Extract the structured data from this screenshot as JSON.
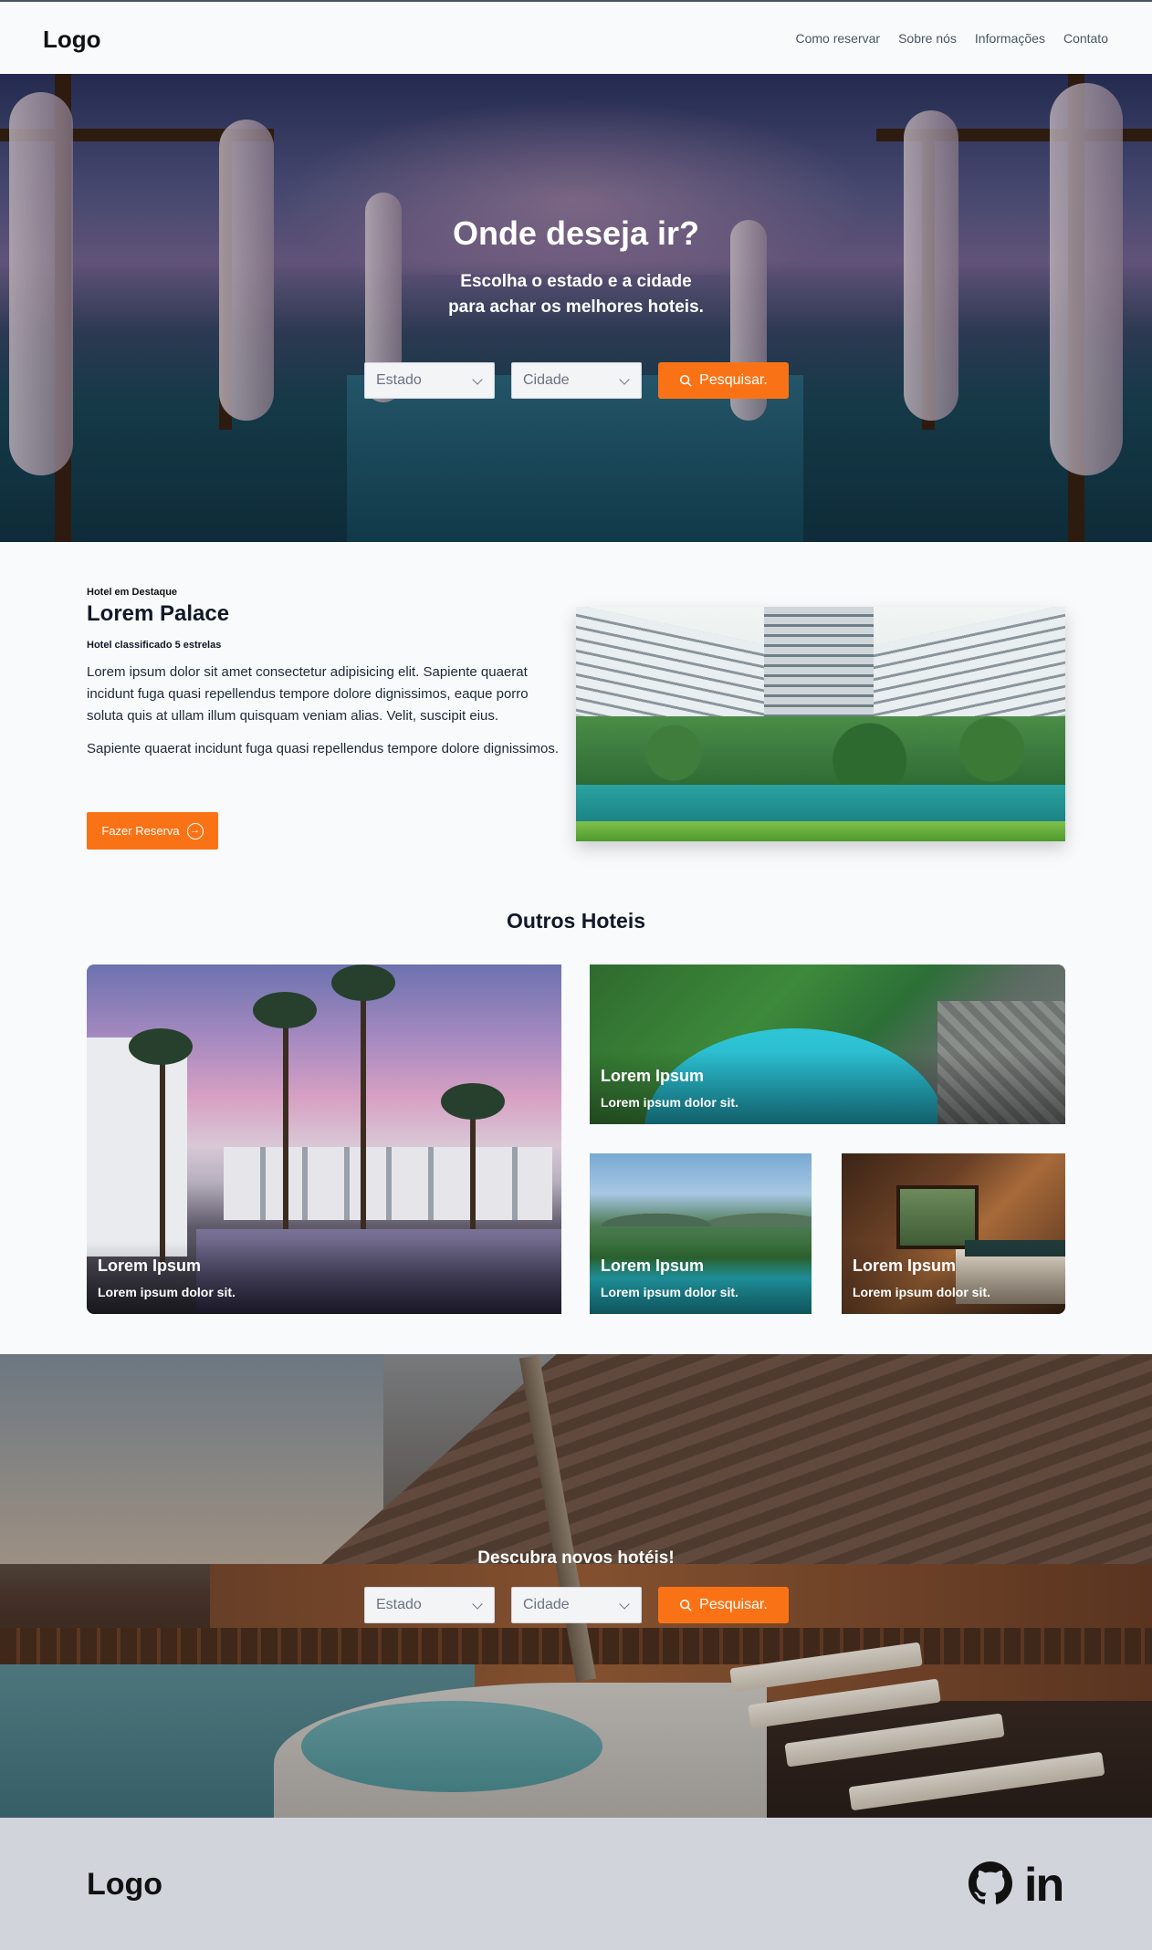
{
  "nav": {
    "logo": "Logo",
    "links": [
      "Como reservar",
      "Sobre nós",
      "Informações",
      "Contato"
    ]
  },
  "hero": {
    "title": "Onde deseja ir?",
    "subtitle_line1": "Escolha o estado e a cidade",
    "subtitle_line2": "para achar os melhores hoteis.",
    "state_placeholder": "Estado",
    "city_placeholder": "Cidade",
    "search_label": "Pesquisar."
  },
  "featured": {
    "eyebrow": "Hotel em Destaque",
    "title": "Lorem Palace",
    "rating": "Hotel classificado 5 estrelas",
    "paragraph1": "Lorem ipsum dolor sit amet consectetur adipisicing elit. Sapiente quaerat incidunt fuga quasi repellendus tempore dolore dignissimos, eaque porro soluta quis at ullam illum quisquam veniam alias. Velit, suscipit eius.",
    "paragraph2": "Sapiente quaerat incidunt fuga quasi repellendus tempore dolore dignissimos.",
    "button_label": "Fazer Reserva"
  },
  "others": {
    "title": "Outros Hoteis",
    "cards": [
      {
        "title": "Lorem Ipsum",
        "subtitle": "Lorem ipsum dolor sit."
      },
      {
        "title": "Lorem Ipsum",
        "subtitle": "Lorem ipsum dolor sit."
      },
      {
        "title": "Lorem Ipsum",
        "subtitle": "Lorem ipsum dolor sit."
      },
      {
        "title": "Lorem Ipsum",
        "subtitle": "Lorem ipsum dolor sit."
      }
    ]
  },
  "discover": {
    "title": "Descubra novos hotéis!",
    "state_placeholder": "Estado",
    "city_placeholder": "Cidade",
    "search_label": "Pesquisar."
  },
  "footer": {
    "logo": "Logo",
    "icons": [
      "github-icon",
      "linkedin-icon"
    ],
    "linkedin_text": "in"
  },
  "colors": {
    "accent": "#f97316",
    "footer_bg": "#d1d5db",
    "page_bg": "#f8fafc"
  }
}
